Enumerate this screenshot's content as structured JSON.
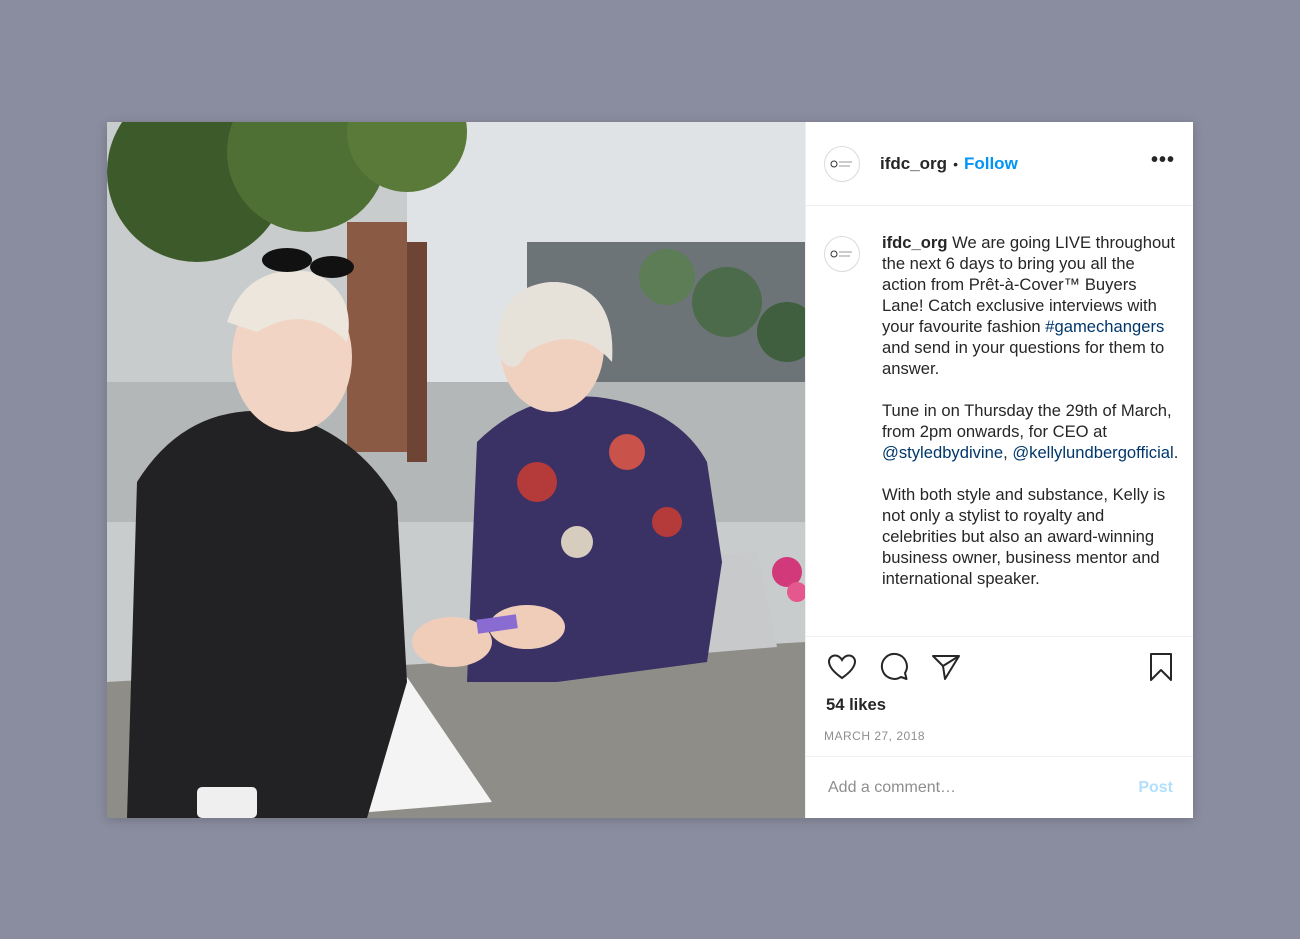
{
  "post": {
    "username": "ifdc_org",
    "separator": "•",
    "follow_label": "Follow",
    "more_label": "•••",
    "caption": {
      "username": "ifdc_org",
      "p1_text": " We are going LIVE throughout the next 6 days to bring you all the action from Prêt-à-Cover™ Buyers Lane! Catch exclusive interviews with your favourite fashion ",
      "p1_hashtag": "#gamechangers",
      "p1_tail": " and send in your questions for them to answer.",
      "p2_text": "Tune in on Thursday the 29th of March, from 2pm onwards, for CEO at ",
      "p2_mention1": "@styledbydivine",
      "p2_sep": ", ",
      "p2_mention2": "@kellylundbergofficial",
      "p2_tail": ".",
      "p3_text": "With both style and substance, Kelly is not only a stylist to royalty and celebrities but also an award-winning business owner, business mentor and international speaker."
    },
    "likes": "54 likes",
    "date": "MARCH 27, 2018",
    "comment_placeholder": "Add a comment…",
    "post_label": "Post"
  },
  "icons": {
    "like": "heart-icon",
    "comment": "comment-icon",
    "share": "paper-plane-icon",
    "save": "bookmark-icon"
  },
  "colors": {
    "background": "#8a8d9f",
    "follow": "#0095f6",
    "link": "#00376b",
    "post_disabled": "#b2dffc",
    "muted": "#8e8e8e"
  }
}
